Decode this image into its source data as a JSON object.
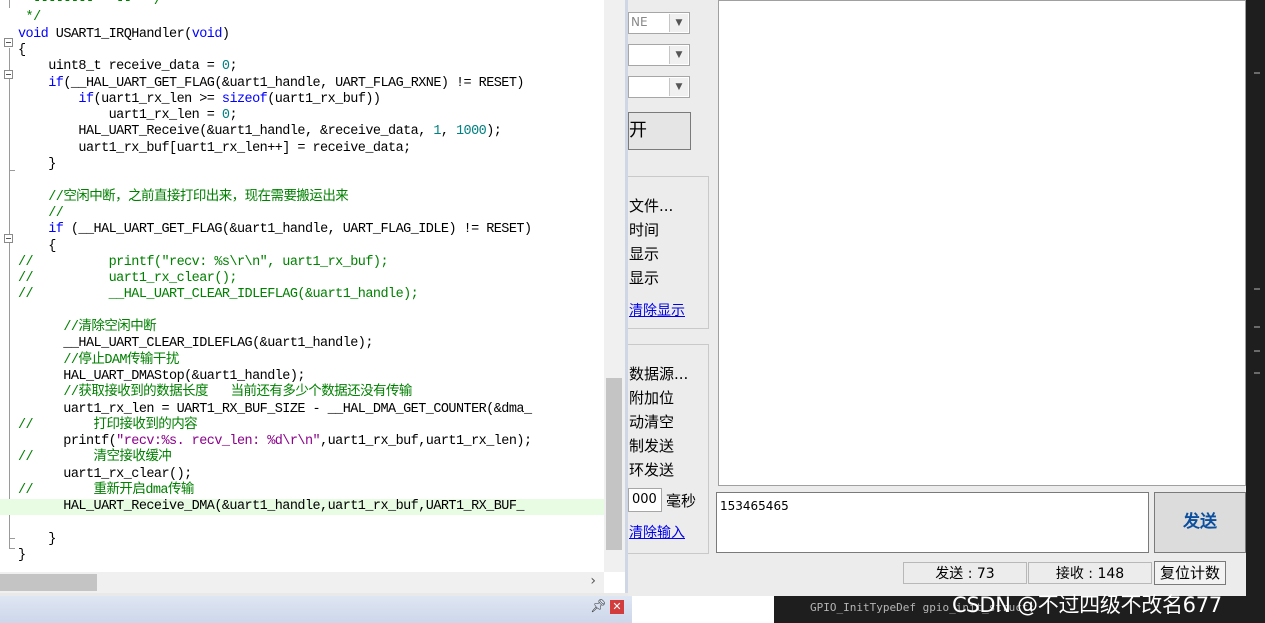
{
  "editor": {
    "code_lines": [
      {
        "segments": [
          {
            "t": "  ",
            "c": ""
          },
          {
            "t": "--------   --  */",
            "c": "cm"
          }
        ]
      },
      {
        "segments": [
          {
            "t": " */",
            "c": "cm"
          }
        ]
      },
      {
        "segments": [
          {
            "t": "void",
            "c": "kw"
          },
          {
            "t": " USART1_IRQHandler(",
            "c": ""
          },
          {
            "t": "void",
            "c": "kw"
          },
          {
            "t": ")",
            "c": ""
          }
        ]
      },
      {
        "segments": [
          {
            "t": "{",
            "c": ""
          }
        ]
      },
      {
        "segments": [
          {
            "t": "    uint8_t receive_data = ",
            "c": ""
          },
          {
            "t": "0",
            "c": "num"
          },
          {
            "t": ";",
            "c": ""
          }
        ]
      },
      {
        "segments": [
          {
            "t": "    ",
            "c": ""
          },
          {
            "t": "if",
            "c": "kw"
          },
          {
            "t": "(__HAL_UART_GET_FLAG(&uart1_handle, UART_FLAG_RXNE) != RESET)",
            "c": ""
          }
        ]
      },
      {
        "segments": [
          {
            "t": "        ",
            "c": ""
          },
          {
            "t": "if",
            "c": "kw"
          },
          {
            "t": "(uart1_rx_len >= ",
            "c": ""
          },
          {
            "t": "sizeof",
            "c": "kw"
          },
          {
            "t": "(uart1_rx_buf))",
            "c": ""
          }
        ]
      },
      {
        "segments": [
          {
            "t": "            uart1_rx_len = ",
            "c": ""
          },
          {
            "t": "0",
            "c": "num"
          },
          {
            "t": ";",
            "c": ""
          }
        ]
      },
      {
        "segments": [
          {
            "t": "        HAL_UART_Receive(&uart1_handle, &receive_data, ",
            "c": ""
          },
          {
            "t": "1",
            "c": "num"
          },
          {
            "t": ", ",
            "c": ""
          },
          {
            "t": "1000",
            "c": "num"
          },
          {
            "t": ");",
            "c": ""
          }
        ]
      },
      {
        "segments": [
          {
            "t": "        uart1_rx_buf[uart1_rx_len++] = receive_data;",
            "c": ""
          }
        ]
      },
      {
        "segments": [
          {
            "t": "    }",
            "c": ""
          }
        ]
      },
      {
        "segments": [
          {
            "t": "",
            "c": ""
          }
        ]
      },
      {
        "segments": [
          {
            "t": "    ",
            "c": ""
          },
          {
            "t": "//空闲中断，之前直接打印出来，现在需要搬运出来",
            "c": "cm"
          }
        ]
      },
      {
        "segments": [
          {
            "t": "    ",
            "c": ""
          },
          {
            "t": "//",
            "c": "cm"
          }
        ]
      },
      {
        "segments": [
          {
            "t": "    ",
            "c": ""
          },
          {
            "t": "if",
            "c": "kw"
          },
          {
            "t": " (__HAL_UART_GET_FLAG(&uart1_handle, UART_FLAG_IDLE) != RESET)",
            "c": ""
          }
        ]
      },
      {
        "segments": [
          {
            "t": "    {",
            "c": ""
          }
        ]
      },
      {
        "segments": [
          {
            "t": "//          printf(\"recv: %s\\r\\n\", uart1_rx_buf);",
            "c": "cm"
          }
        ]
      },
      {
        "segments": [
          {
            "t": "//          uart1_rx_clear();",
            "c": "cm"
          }
        ]
      },
      {
        "segments": [
          {
            "t": "//          __HAL_UART_CLEAR_IDLEFLAG(&uart1_handle);",
            "c": "cm"
          }
        ]
      },
      {
        "segments": [
          {
            "t": "",
            "c": ""
          }
        ]
      },
      {
        "segments": [
          {
            "t": "      ",
            "c": ""
          },
          {
            "t": "//清除空闲中断",
            "c": "cm"
          }
        ]
      },
      {
        "segments": [
          {
            "t": "      __HAL_UART_CLEAR_IDLEFLAG(&uart1_handle);",
            "c": ""
          }
        ]
      },
      {
        "segments": [
          {
            "t": "      ",
            "c": ""
          },
          {
            "t": "//停止DAM传输干扰",
            "c": "cm"
          }
        ]
      },
      {
        "segments": [
          {
            "t": "      HAL_UART_DMAStop(&uart1_handle);",
            "c": ""
          }
        ]
      },
      {
        "segments": [
          {
            "t": "      ",
            "c": ""
          },
          {
            "t": "//获取接收到的数据长度   当前还有多少个数据还没有传输",
            "c": "cm"
          }
        ]
      },
      {
        "segments": [
          {
            "t": "      uart1_rx_len = UART1_RX_BUF_SIZE - __HAL_DMA_GET_COUNTER(&dma_",
            "c": ""
          }
        ]
      },
      {
        "segments": [
          {
            "t": "//        打印接收到的内容",
            "c": "cm"
          }
        ]
      },
      {
        "segments": [
          {
            "t": "      printf(",
            "c": ""
          },
          {
            "t": "\"recv:%s. recv_len: %d\\r\\n\"",
            "c": "str"
          },
          {
            "t": ",uart1_rx_buf,uart1_rx_len);",
            "c": ""
          }
        ]
      },
      {
        "segments": [
          {
            "t": "//        清空接收缓冲",
            "c": "cm"
          }
        ]
      },
      {
        "segments": [
          {
            "t": "      uart1_rx_clear();",
            "c": ""
          }
        ]
      },
      {
        "segments": [
          {
            "t": "//        重新开启dma传输",
            "c": "cm"
          }
        ]
      },
      {
        "segments": [
          {
            "t": "      HAL_UART_Receive_DMA(&uart1_handle,uart1_rx_buf,UART1_RX_BUF_",
            "c": ""
          }
        ]
      },
      {
        "segments": [
          {
            "t": "",
            "c": ""
          }
        ]
      },
      {
        "segments": [
          {
            "t": "    }",
            "c": ""
          }
        ]
      },
      {
        "segments": [
          {
            "t": "}",
            "c": ""
          }
        ]
      }
    ],
    "scroll_right_arrow": "›",
    "pin_glyph": "ᵖ",
    "close_glyph": "✕"
  },
  "serial": {
    "dropdown_1": "NE",
    "dropdown_2": "",
    "dropdown_3": "",
    "open_button": "开",
    "recv_options": [
      "文件...",
      "时间",
      "显示",
      "显示"
    ],
    "clear_display": "清除显示",
    "send_options": [
      "数据源...",
      "附加位",
      "动清空",
      "制发送",
      "环发送"
    ],
    "period_value": "000",
    "period_unit": "毫秒",
    "clear_input": "清除输入",
    "send_text": "153465465",
    "send_button": "发送",
    "tx_count": "发送 : 73",
    "rx_count": "接收 : 148",
    "reset_count": "复位计数"
  },
  "bottom": {
    "code_snippet": "GPIO_InitTypeDef gpio_init_struct;",
    "watermark": "CSDN @不过四级不改名677"
  }
}
